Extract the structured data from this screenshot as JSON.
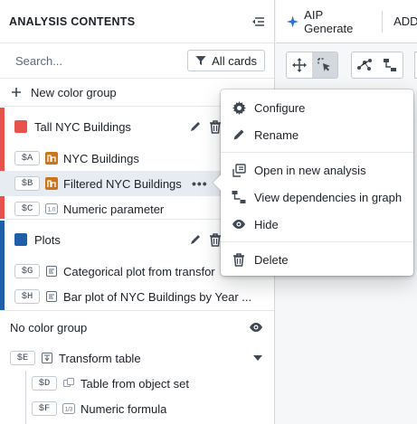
{
  "panel": {
    "title": "ANALYSIS CONTENTS",
    "search_placeholder": "Search...",
    "filter_label": "All cards",
    "new_group_label": "New color group"
  },
  "groups": [
    {
      "name": "Tall NYC Buildings",
      "color": "#e5534b",
      "cards": [
        {
          "tag": "$A",
          "icon": "object-set-icon",
          "label": "NYC Buildings"
        },
        {
          "tag": "$B",
          "icon": "object-set-icon",
          "label": "Filtered NYC Buildings"
        },
        {
          "tag": "$C",
          "icon": "numeric-icon",
          "label": "Numeric parameter"
        }
      ]
    },
    {
      "name": "Plots",
      "color": "#1f5fa8",
      "cards": [
        {
          "tag": "$G",
          "icon": "chart-icon",
          "label": "Categorical plot from transfor"
        },
        {
          "tag": "$H",
          "icon": "chart-icon",
          "label": "Bar plot of NYC Buildings by Year ..."
        }
      ]
    }
  ],
  "no_color_group": {
    "label": "No color group",
    "cards": [
      {
        "tag": "$E",
        "icon": "transform-table-icon",
        "label": "Transform table"
      },
      {
        "tag": "$D",
        "icon": "table-icon",
        "label": "Table from object set"
      },
      {
        "tag": "$F",
        "icon": "formula-icon",
        "label": "Numeric formula"
      }
    ]
  },
  "topbar": {
    "aip_label": "AIP Generate",
    "add_label": "ADD"
  },
  "context_menu": {
    "items": [
      {
        "label": "Configure",
        "icon": "gear-icon"
      },
      {
        "label": "Rename",
        "icon": "pencil-icon"
      },
      {
        "label": "Open in new analysis",
        "icon": "open-new-icon"
      },
      {
        "label": "View dependencies in graph",
        "icon": "graph-icon"
      },
      {
        "label": "Hide",
        "icon": "eye-icon"
      },
      {
        "label": "Delete",
        "icon": "trash-icon"
      }
    ]
  },
  "colors": {
    "accent": "#2d72d2",
    "object_icon": "#c87619",
    "selected_row": "#e7ecf2"
  }
}
